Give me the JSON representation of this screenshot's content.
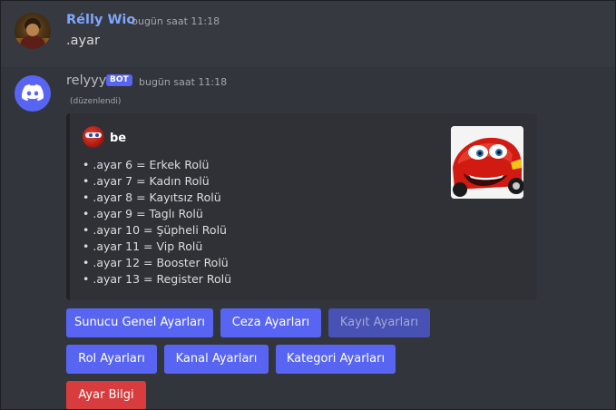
{
  "message_user": {
    "username": "Rélly Wio",
    "timestamp": "bugün saat 11:18",
    "content": ".ayar"
  },
  "message_bot": {
    "username": "relyyy",
    "bot_tag": "BOT",
    "timestamp": "bugün saat 11:18",
    "edited": "(düzenlendi)",
    "embed": {
      "author": "be",
      "lines": [
        "• .ayar 6 = Erkek Rolü",
        "• .ayar 7 = Kadın Rolü",
        "• .ayar 8 = Kayıtsız Rolü",
        "• .ayar 9 = Taglı Rolü",
        "• .ayar 10 = Şüpheli Rolü",
        "• .ayar 11 = Vip Rolü",
        "• .ayar 12 = Booster Rolü",
        "• .ayar 13 = Register Rolü"
      ],
      "thumbnail_icon": "red-race-car-image"
    },
    "buttons": [
      {
        "label": "Sunucu Genel Ayarları",
        "style": "primary"
      },
      {
        "label": "Ceza Ayarları",
        "style": "primary"
      },
      {
        "label": "Kayıt Ayarları",
        "style": "primary-disabled"
      },
      {
        "label": "Rol Ayarları",
        "style": "primary"
      },
      {
        "label": "Kanal Ayarları",
        "style": "primary"
      },
      {
        "label": "Kategori Ayarları",
        "style": "primary"
      },
      {
        "label": "Ayar Bilgi",
        "style": "danger"
      }
    ]
  },
  "colors": {
    "background": "#36393f",
    "blurple": "#5865f2",
    "danger": "#d83c3e",
    "username_user": "#7ea6ff"
  }
}
